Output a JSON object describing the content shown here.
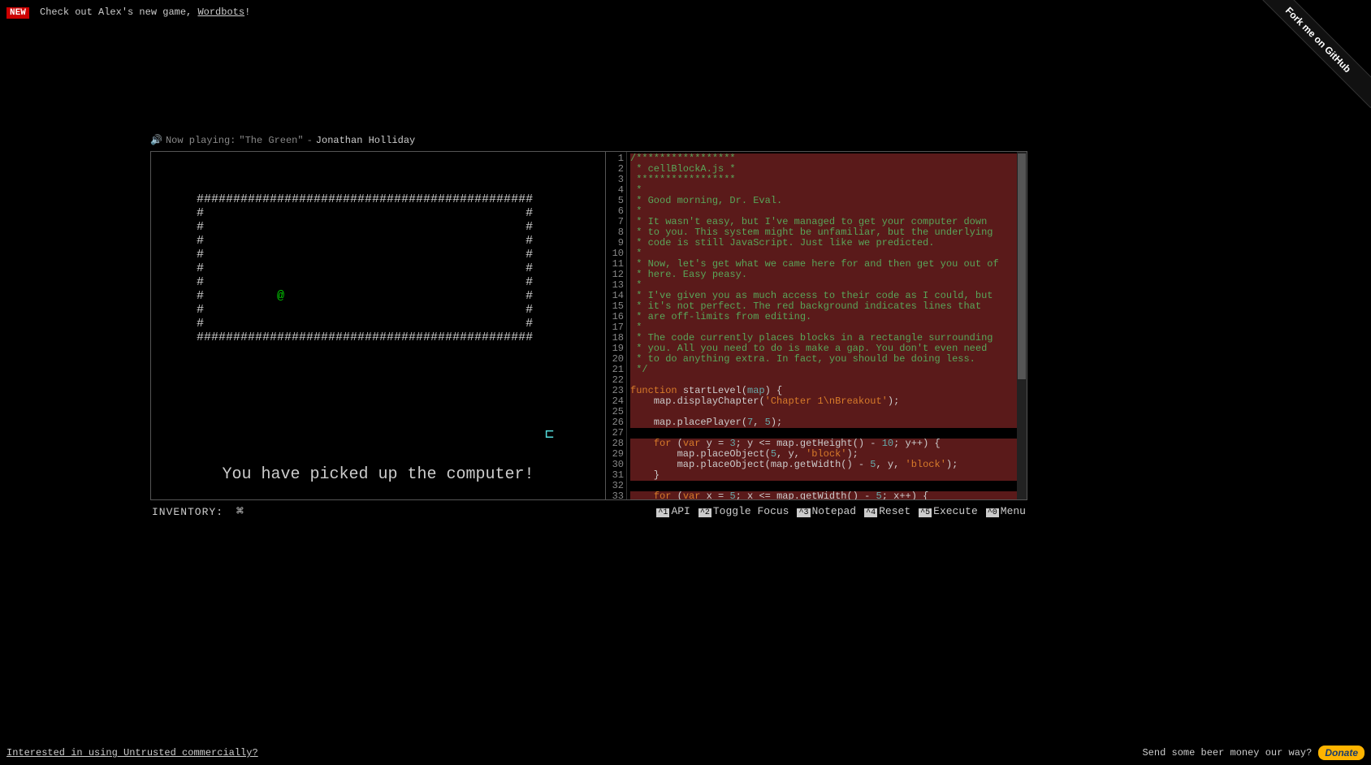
{
  "banner": {
    "badge": "NEW",
    "text_before": "Check out Alex's new game, ",
    "link_text": "Wordbots",
    "text_after": "!"
  },
  "github_ribbon": "Fork me on GitHub",
  "now_playing": {
    "prefix": "Now playing: ",
    "track": "\"The Green\"",
    "sep": " - ",
    "artist": "Jonathan Holliday"
  },
  "game": {
    "map_rows": [
      "##############################################",
      "#                                            #",
      "#                                            #",
      "#                                            #",
      "#                                            #",
      "#                                            #",
      "#                                            #",
      "#          @                                 #",
      "#                                            #",
      "#                                            #",
      "##############################################"
    ],
    "exit_glyph": "⊏",
    "message": "You have picked up the computer!"
  },
  "inventory": {
    "label": "INVENTORY:",
    "items": [
      "⌘"
    ]
  },
  "toolbar": {
    "api_key": "^1",
    "api": "API",
    "focus_key": "^2",
    "focus": "Toggle Focus",
    "notepad_key": "^3",
    "notepad": "Notepad",
    "reset_key": "^4",
    "reset": "Reset",
    "execute_key": "^5",
    "execute": "Execute",
    "menu_key": "^0",
    "menu": "Menu"
  },
  "code": {
    "lines": [
      {
        "n": 1,
        "locked": true,
        "cls": "cm-comment",
        "text": "/*****************"
      },
      {
        "n": 2,
        "locked": true,
        "cls": "cm-comment",
        "text": " * cellBlockA.js *"
      },
      {
        "n": 3,
        "locked": true,
        "cls": "cm-comment",
        "text": " *****************"
      },
      {
        "n": 4,
        "locked": true,
        "cls": "cm-comment",
        "text": " *"
      },
      {
        "n": 5,
        "locked": true,
        "cls": "cm-comment",
        "text": " * Good morning, Dr. Eval."
      },
      {
        "n": 6,
        "locked": true,
        "cls": "cm-comment",
        "text": " *"
      },
      {
        "n": 7,
        "locked": true,
        "cls": "cm-comment",
        "text": " * It wasn't easy, but I've managed to get your computer down"
      },
      {
        "n": 8,
        "locked": true,
        "cls": "cm-comment",
        "text": " * to you. This system might be unfamiliar, but the underlying"
      },
      {
        "n": 9,
        "locked": true,
        "cls": "cm-comment",
        "text": " * code is still JavaScript. Just like we predicted."
      },
      {
        "n": 10,
        "locked": true,
        "cls": "cm-comment",
        "text": " *"
      },
      {
        "n": 11,
        "locked": true,
        "cls": "cm-comment",
        "text": " * Now, let's get what we came here for and then get you out of"
      },
      {
        "n": 12,
        "locked": true,
        "cls": "cm-comment",
        "text": " * here. Easy peasy."
      },
      {
        "n": 13,
        "locked": true,
        "cls": "cm-comment",
        "text": " *"
      },
      {
        "n": 14,
        "locked": true,
        "cls": "cm-comment",
        "text": " * I've given you as much access to their code as I could, but"
      },
      {
        "n": 15,
        "locked": true,
        "cls": "cm-comment",
        "text": " * it's not perfect. The red background indicates lines that"
      },
      {
        "n": 16,
        "locked": true,
        "cls": "cm-comment",
        "text": " * are off-limits from editing."
      },
      {
        "n": 17,
        "locked": true,
        "cls": "cm-comment",
        "text": " *"
      },
      {
        "n": 18,
        "locked": true,
        "cls": "cm-comment",
        "text": " * The code currently places blocks in a rectangle surrounding"
      },
      {
        "n": 19,
        "locked": true,
        "cls": "cm-comment",
        "text": " * you. All you need to do is make a gap. You don't even need"
      },
      {
        "n": 20,
        "locked": true,
        "cls": "cm-comment",
        "text": " * to do anything extra. In fact, you should be doing less."
      },
      {
        "n": 21,
        "locked": true,
        "cls": "cm-comment",
        "text": " */"
      },
      {
        "n": 22,
        "locked": true,
        "cls": "",
        "text": ""
      },
      {
        "n": 23,
        "locked": true,
        "html": "<span class=\"cm-keyword\">function</span> <span class=\"cm-def\">startLevel</span><span class=\"cm-paren\">(</span><span class=\"cm-param\">map</span><span class=\"cm-paren\">) {</span>"
      },
      {
        "n": 24,
        "locked": true,
        "html": "    <span class=\"cm-var\">map</span>.<span class=\"cm-prop\">displayChapter</span>(<span class=\"cm-string\">'Chapter 1\\nBreakout'</span>);"
      },
      {
        "n": 25,
        "locked": true,
        "cls": "",
        "text": ""
      },
      {
        "n": 26,
        "locked": true,
        "html": "    <span class=\"cm-var\">map</span>.<span class=\"cm-prop\">placePlayer</span>(<span class=\"cm-num\">7</span>, <span class=\"cm-num\">5</span>);"
      },
      {
        "n": 27,
        "locked": false,
        "cls": "",
        "text": ""
      },
      {
        "n": 28,
        "locked": true,
        "html": "    <span class=\"cm-keyword\">for</span> (<span class=\"cm-keyword\">var</span> <span class=\"cm-var\">y</span> = <span class=\"cm-num\">3</span>; y &lt;= <span class=\"cm-var\">map</span>.<span class=\"cm-prop\">getHeight</span>() - <span class=\"cm-num\">10</span>; y++) {"
      },
      {
        "n": 29,
        "locked": true,
        "html": "        <span class=\"cm-var\">map</span>.<span class=\"cm-prop\">placeObject</span>(<span class=\"cm-num\">5</span>, y, <span class=\"cm-string\">'block'</span>);"
      },
      {
        "n": 30,
        "locked": true,
        "html": "        <span class=\"cm-var\">map</span>.<span class=\"cm-prop\">placeObject</span>(<span class=\"cm-var\">map</span>.<span class=\"cm-prop\">getWidth</span>() - <span class=\"cm-num\">5</span>, y, <span class=\"cm-string\">'block'</span>);"
      },
      {
        "n": 31,
        "locked": true,
        "cls": "cm-paren",
        "text": "    }"
      },
      {
        "n": 32,
        "locked": false,
        "cls": "",
        "text": ""
      },
      {
        "n": 33,
        "locked": true,
        "html": "    <span class=\"cm-keyword\">for</span> (<span class=\"cm-keyword\">var</span> <span class=\"cm-var\">x</span> = <span class=\"cm-num\">5</span>; x &lt;= <span class=\"cm-var\">map</span>.<span class=\"cm-prop\">getWidth</span>() - <span class=\"cm-num\">5</span>; x++) {"
      }
    ]
  },
  "footer": {
    "left_link": "Interested in using Untrusted commercially?",
    "right_text": "Send some beer money our way?",
    "donate": "Donate"
  }
}
